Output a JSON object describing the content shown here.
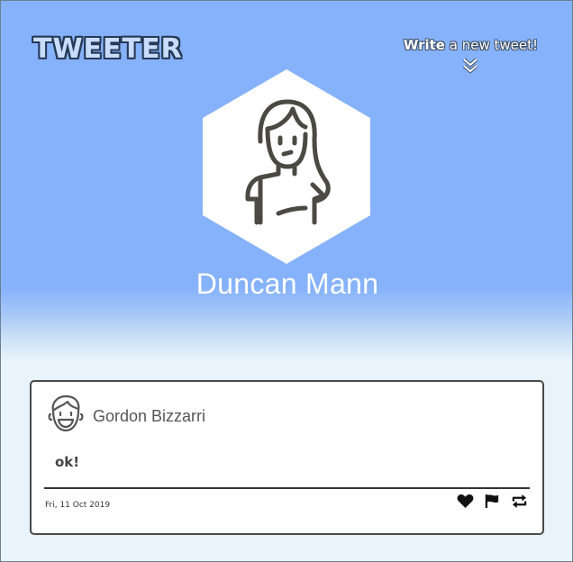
{
  "header": {
    "logo_text": "TWEETER",
    "compose_bold": "Write",
    "compose_rest": " a new tweet!"
  },
  "profile": {
    "name": "Duncan Mann",
    "avatar_icon": "user-female-avatar-icon"
  },
  "tweet": {
    "author": "Gordon Bizzarri",
    "author_avatar_icon": "smiling-man-avatar-icon",
    "text": "ok!",
    "date": "Fri, 11 Oct 2019",
    "actions": [
      "heart-icon",
      "flag-icon",
      "retweet-icon"
    ]
  },
  "colors": {
    "header_background": "#86b2fb",
    "page_background": "#e9f3fb",
    "logo_fill": "#c7ddfb",
    "logo_outline": "#263a57",
    "avatar_stroke": "#4a4a42"
  }
}
